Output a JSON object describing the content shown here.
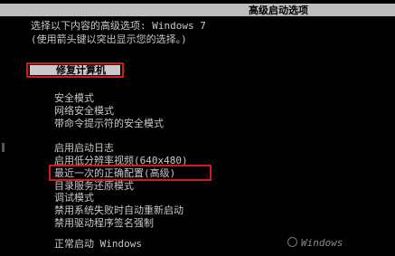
{
  "screen": {
    "title": "高级启动选项",
    "intro_line1": "选择以下内容的高级选项: Windows 7",
    "intro_line2": "(使用箭头键以突出显示您的选择。)"
  },
  "repair_option": {
    "label": "修复计算机"
  },
  "safe_mode_group": [
    {
      "label": "安全模式"
    },
    {
      "label": "网络安全模式"
    },
    {
      "label": "带命令提示符的安全模式"
    }
  ],
  "advanced_group": [
    {
      "label": "启用启动日志"
    },
    {
      "label": "启用低分辨率视频(640x480)"
    },
    {
      "label": "最近一次的正确配置(高级)"
    },
    {
      "label": "目录服务还原模式"
    },
    {
      "label": "调试模式"
    },
    {
      "label": "禁用系统失败时自动重新启动"
    },
    {
      "label": "禁用驱动程序签名强制"
    }
  ],
  "normal_start": {
    "label": "正常启动 Windows"
  },
  "watermark": {
    "text": "Windows"
  },
  "colors": {
    "background": "#000000",
    "text": "#c8c8c8",
    "title_bar": "#bdbdbd",
    "highlight_box": "#d21a1a"
  }
}
